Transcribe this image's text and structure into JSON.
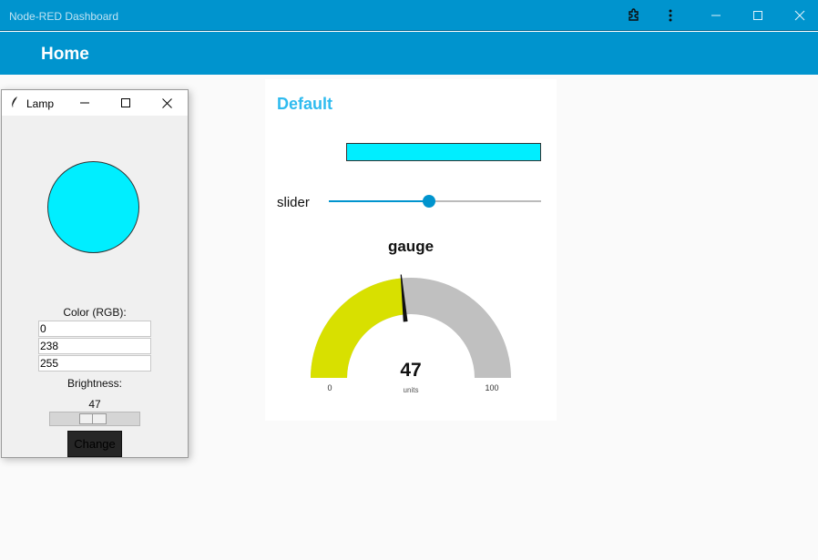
{
  "app": {
    "title": "Node-RED Dashboard",
    "accent": "#0094ce",
    "header_icons": [
      "puzzle-icon",
      "kebab-menu-icon",
      "minimize-icon",
      "maximize-icon",
      "close-icon"
    ]
  },
  "toolbar": {
    "page_title": "Home"
  },
  "group": {
    "title": "Default",
    "color_bar": {
      "color": "#00eeff"
    },
    "slider": {
      "label": "slider",
      "value": 47,
      "min": 0,
      "max": 100
    },
    "gauge": {
      "title": "gauge",
      "value": "47",
      "value_num": 47,
      "units": "units",
      "min_label": "0",
      "max_label": "100",
      "fill_color": "#d8e000",
      "bg_color": "#c0c0c0"
    }
  },
  "lamp": {
    "window_title": "Lamp",
    "circle_color": "#00eeff",
    "color_label": "Color (RGB):",
    "rgb": [
      "0",
      "238",
      "255"
    ],
    "brightness_label": "Brightness:",
    "brightness_value": "47",
    "brightness_num": 47,
    "change_label": "Change"
  }
}
